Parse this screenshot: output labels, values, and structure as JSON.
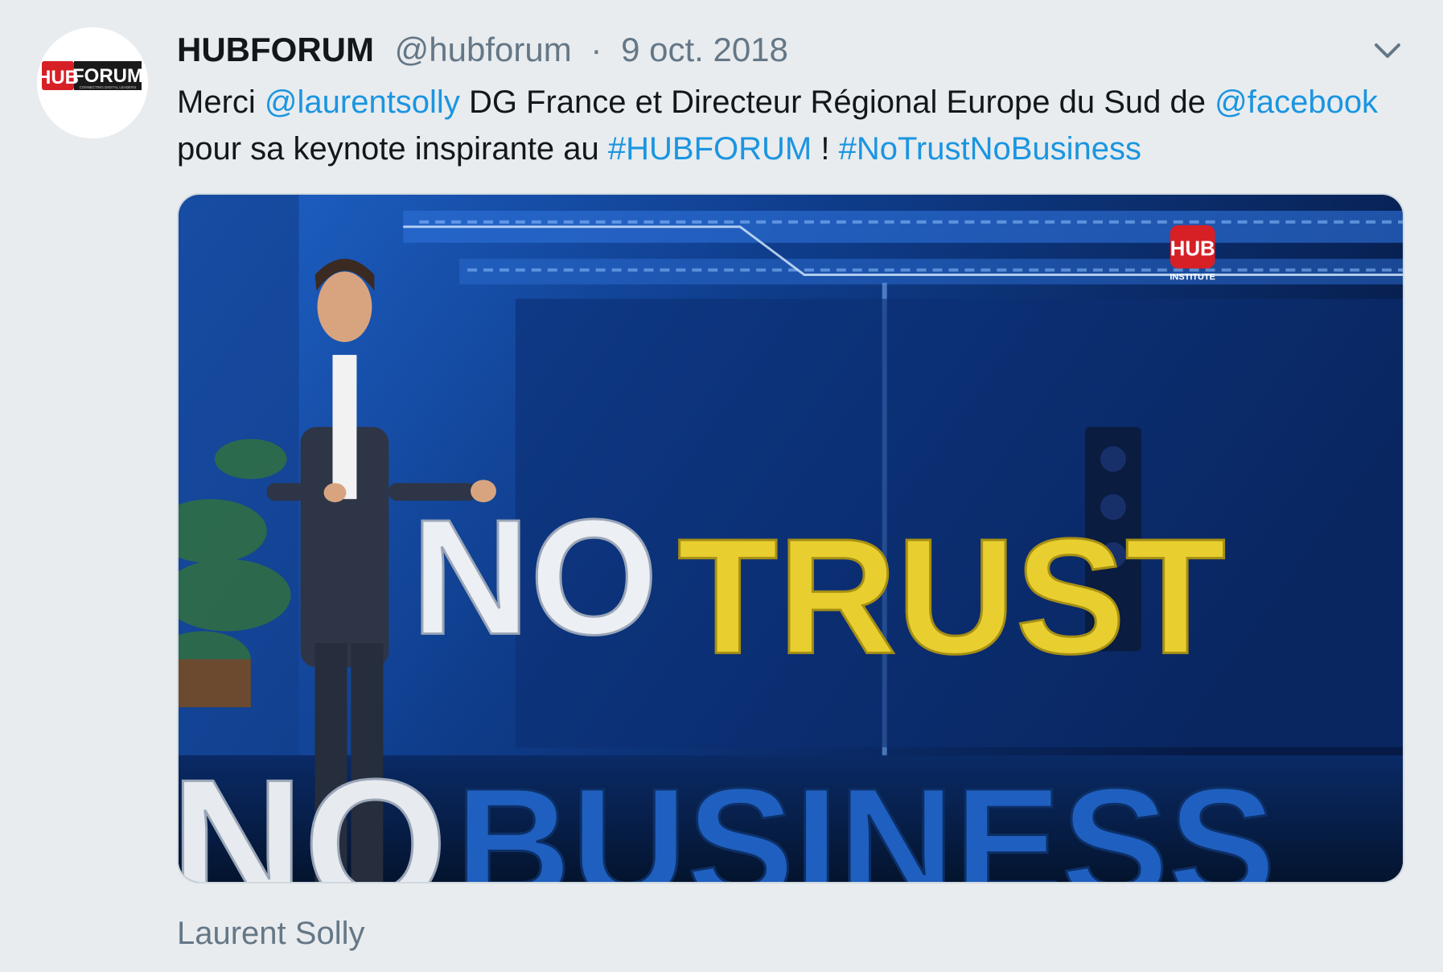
{
  "author": {
    "display_name": "HUBFORUM",
    "handle": "@hubforum",
    "separator": "·",
    "date": "9 oct. 2018",
    "avatar": {
      "logo_hub": "HUB",
      "logo_forum": "FORUM",
      "logo_tagline": "CONNECTING DIGITAL LEADERS"
    }
  },
  "menu_icon": "chevron-down-icon",
  "tweet": {
    "segments": [
      {
        "text": "Merci ",
        "type": "text"
      },
      {
        "text": "@laurentsolly",
        "type": "mention"
      },
      {
        "text": " DG France et Directeur Régional Europe du Sud de ",
        "type": "text"
      },
      {
        "text": "@facebook",
        "type": "mention"
      },
      {
        "text": " pour sa keynote inspirante au ",
        "type": "text"
      },
      {
        "text": "#HUBFORUM",
        "type": "hashtag"
      },
      {
        "text": " ! ",
        "type": "text"
      },
      {
        "text": "#NoTrustNoBusiness",
        "type": "hashtag"
      }
    ]
  },
  "media": {
    "sign_no": "NO",
    "sign_trust": "TRUST",
    "sign_no2": "NO",
    "sign_business": "BUSINESS",
    "watermark_hub": "HUB",
    "watermark_institute": "INSTITUTE"
  },
  "caption": "Laurent Solly",
  "colors": {
    "link": "#1b95e0",
    "secondary_text": "#657786",
    "background": "#e8ecef",
    "brand_red": "#d71f26",
    "sign_yellow": "#e8cf2f"
  }
}
